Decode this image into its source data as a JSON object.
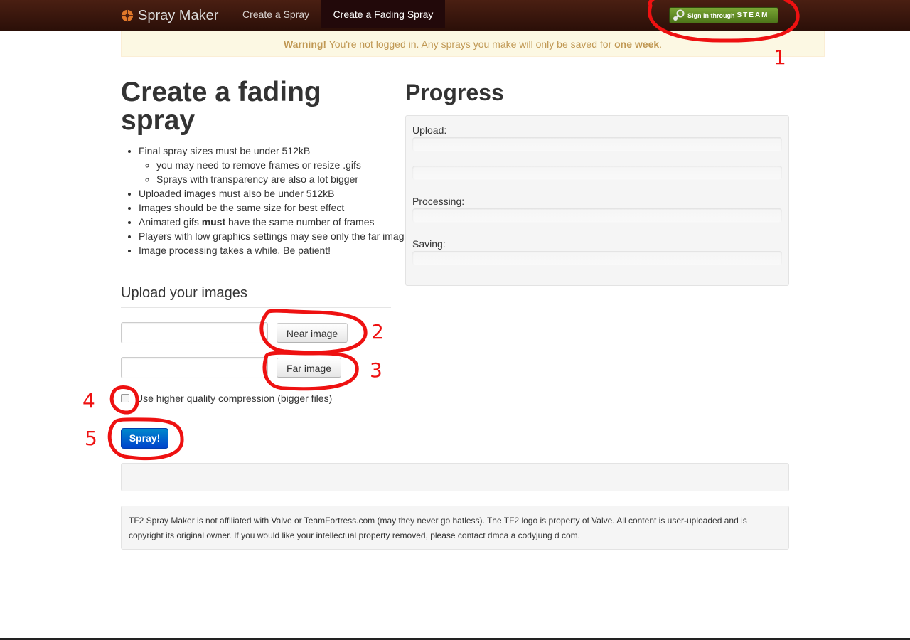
{
  "nav": {
    "brand": "Spray Maker",
    "links": [
      "Create a Spray",
      "Create a Fading Spray"
    ],
    "steam_signin_small": "Sign in through",
    "steam_signin_word": "STEAM"
  },
  "warning": {
    "prefix": "Warning!",
    "text": " You're not logged in. Any sprays you make will only be saved for ",
    "emphasis": "one week",
    "suffix": "."
  },
  "main": {
    "title": "Create a fading spray",
    "rules": [
      "Final spray sizes must be under 512kB",
      "you may need to remove frames or resize .gifs",
      "Sprays with transparency are also a lot bigger",
      "Uploaded images must also be under 512kB",
      "Images should be the same size for best effect",
      "Animated gifs ",
      "must",
      " have the same number of frames",
      "Players with low graphics settings may see only the far image",
      "Image processing takes a while. Be patient!"
    ],
    "upload_title": "Upload your images",
    "near_button": "Near image",
    "far_button": "Far image",
    "checkbox_label": "Use higher quality compression (bigger files)",
    "spray_button": "Spray!"
  },
  "progress": {
    "title": "Progress",
    "upload_label": "Upload:",
    "processing_label": "Processing:",
    "saving_label": "Saving:"
  },
  "footer": {
    "text": "TF2 Spray Maker is not affiliated with Valve or TeamFortress.com (may they never go hatless). The TF2 logo is property of Valve. All content is user-uploaded and is copyright its original owner. If you would like your intellectual property removed, please contact dmca a codyjung d com."
  },
  "annotations": {
    "color": "#ee1111",
    "labels": [
      "1",
      "2",
      "3",
      "4",
      "5"
    ]
  }
}
